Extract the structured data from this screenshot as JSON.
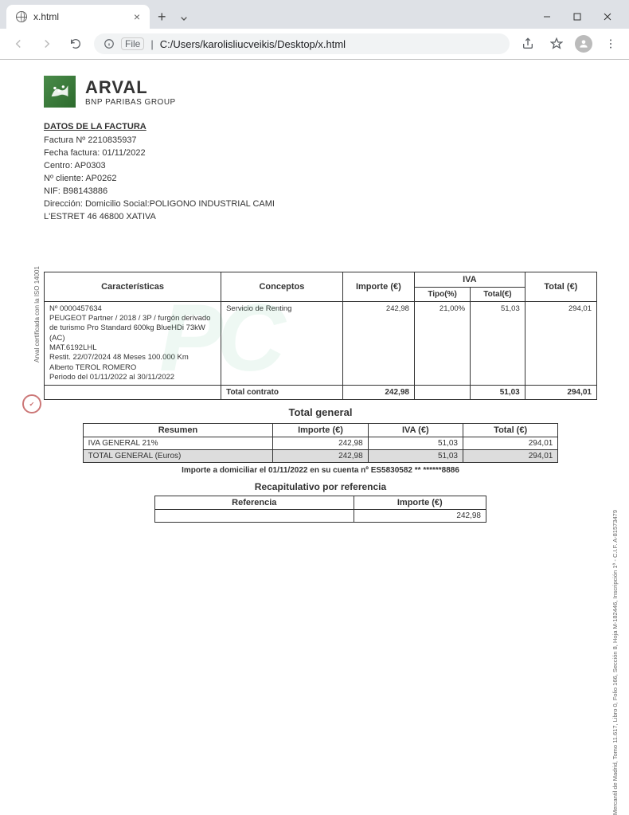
{
  "browser": {
    "tab_title": "x.html",
    "url_prefix": "File",
    "url_path": "C:/Users/karolisliucveikis/Desktop/x.html"
  },
  "logo": {
    "brand": "ARVAL",
    "subtitle": "BNP PARIBAS GROUP"
  },
  "invoice": {
    "section_title": "DATOS DE LA FACTURA",
    "factura_label": "Factura Nº",
    "factura": "2210835937",
    "fecha_label": "Fecha factura:",
    "fecha": "01/11/2022",
    "centro_label": "Centro:",
    "centro": "AP0303",
    "cliente_label": "Nº cliente:",
    "cliente": "AP0262",
    "nif_label": "NIF:",
    "nif": "B98143886",
    "direccion_label": "Dirección:",
    "direccion": "Domicilio Social:POLIGONO INDUSTRIAL CAMI",
    "direccion2": "L'ESTRET 46 46800 XATIVA"
  },
  "table_headers": {
    "caracteristicas": "Características",
    "conceptos": "Conceptos",
    "importe": "Importe (€)",
    "iva": "IVA",
    "iva_tipo": "Tipo(%)",
    "iva_total": "Total(€)",
    "total": "Total (€)"
  },
  "table_rows": [
    {
      "car_line1": "Nº 0000457634",
      "car_line2": "PEUGEOT Partner / 2018 / 3P / furgón derivado de turismo Pro Standard 600kg BlueHDi 73kW (AC)",
      "car_line3": "MAT.6192LHL",
      "car_line4": "Restit. 22/07/2024 48 Meses 100.000 Km",
      "car_line5": "Alberto TEROL ROMERO",
      "car_line6": "Periodo del 01/11/2022 al 30/11/2022",
      "concepto": "Servicio de Renting",
      "importe": "242,98",
      "iva_tipo": "21,00%",
      "iva_total": "51,03",
      "total": "294,01"
    }
  ],
  "table_total": {
    "label": "Total contrato",
    "importe": "242,98",
    "iva_total": "51,03",
    "total": "294,01"
  },
  "total_general_title": "Total  general",
  "summary_headers": {
    "resumen": "Resumen",
    "importe": "Importe (€)",
    "iva": "IVA (€)",
    "total": "Total (€)"
  },
  "summary_rows": [
    {
      "label": "IVA GENERAL 21%",
      "importe": "242,98",
      "iva": "51,03",
      "total": "294,01",
      "shaded": false
    },
    {
      "label": "TOTAL GENERAL (Euros)",
      "importe": "242,98",
      "iva": "51,03",
      "total": "294,01",
      "shaded": true
    }
  ],
  "footer_note": "Importe a domiciliar el 01/11/2022 en su cuenta nº ES5830582 ** ******8886",
  "recap_title": "Recapitulativo por referencia",
  "ref_headers": {
    "referencia": "Referencia",
    "importe": "Importe (€)"
  },
  "ref_rows": [
    {
      "ref": "",
      "importe": "242,98"
    }
  ],
  "side_text": {
    "left": "Arval certificada con la ISO 14001",
    "right": "Mercantil de Madrid, Tomo 11.617, Libro 0, Folio 166, Sección 8, Hoja M-182446, Inscripción 1ª - C.I.F. A-81573479"
  }
}
